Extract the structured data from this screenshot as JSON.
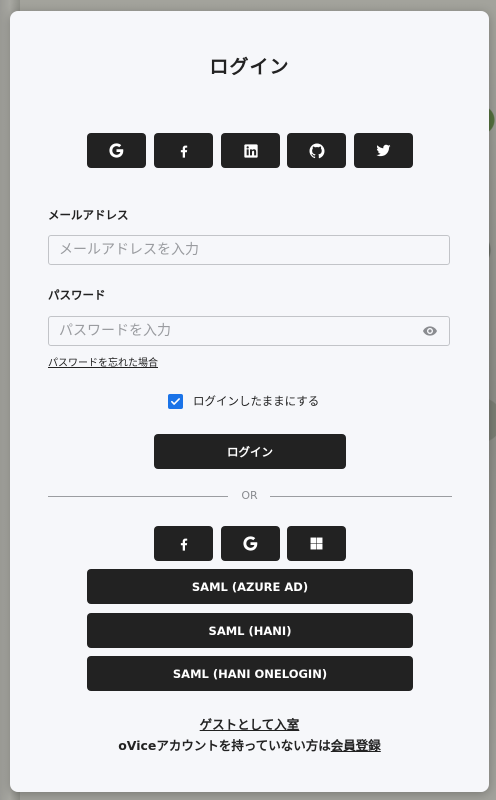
{
  "dialog": {
    "title": "ログイン"
  },
  "social_login": [
    {
      "icon": "google-icon"
    },
    {
      "icon": "facebook-icon"
    },
    {
      "icon": "linkedin-icon"
    },
    {
      "icon": "github-icon"
    },
    {
      "icon": "twitter-icon"
    }
  ],
  "email": {
    "label": "メールアドレス",
    "placeholder": "メールアドレスを入力",
    "value": ""
  },
  "password": {
    "label": "パスワード",
    "placeholder": "パスワードを入力",
    "value": "",
    "toggle_icon": "eye-icon"
  },
  "forgot_password": "パスワードを忘れた場合",
  "remember": {
    "label": "ログインしたままにする",
    "checked": true
  },
  "login_button": "ログイン",
  "divider": "OR",
  "secondary_login": [
    {
      "icon": "facebook-icon"
    },
    {
      "icon": "google-icon"
    },
    {
      "icon": "microsoft-icon"
    }
  ],
  "saml_buttons": [
    "SAML (AZURE AD)",
    "SAML (HANI)",
    "SAML (HANI ONELOGIN)"
  ],
  "guest_link": "ゲストとして入室",
  "signup": {
    "prefix": "oViceアカウントを持っていない方は",
    "link": "会員登録"
  },
  "colors": {
    "button_bg": "#222222",
    "panel_bg": "#f6f7fa",
    "checkbox": "#1a73e8"
  }
}
